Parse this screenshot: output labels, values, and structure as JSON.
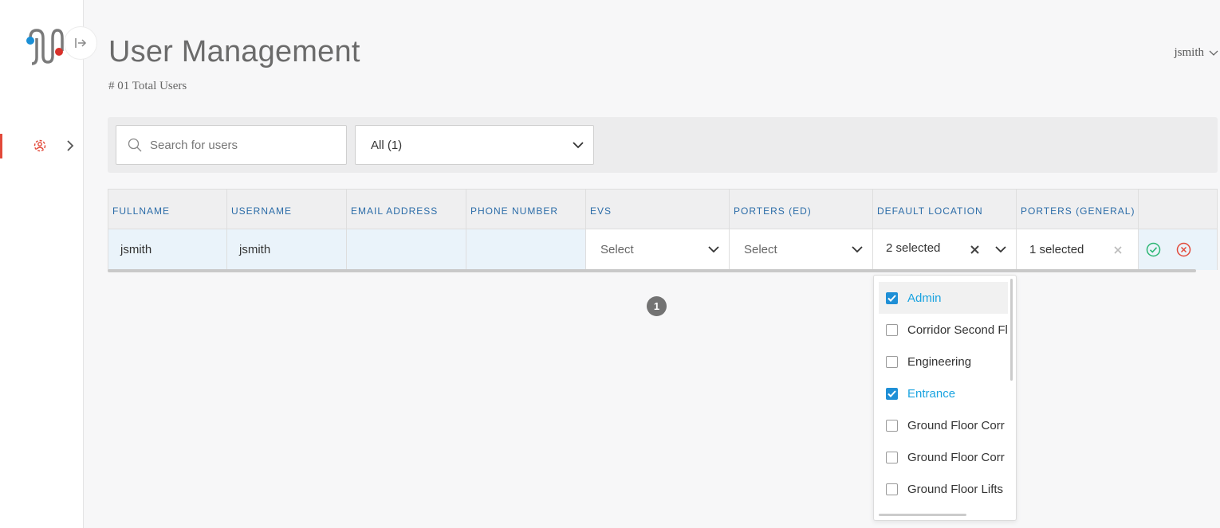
{
  "page": {
    "title": "User Management",
    "total_users": "# 01 Total Users"
  },
  "header": {
    "username": "jsmith"
  },
  "toolbar": {
    "search_placeholder": "Search for users",
    "filter_value": "All (1)"
  },
  "table": {
    "columns": [
      "FULLNAME",
      "USERNAME",
      "EMAIL ADDRESS",
      "PHONE NUMBER",
      "EVS",
      "PORTERS (ED)",
      "DEFAULT LOCATION",
      "PORTERS (GENERAL)",
      ""
    ],
    "row": {
      "fullname": "jsmith",
      "username": "jsmith",
      "email": "",
      "phone": "",
      "evs": "Select",
      "porters_ed": "Select",
      "default_location": "2 selected",
      "porters_general": "1 selected"
    }
  },
  "pagination": {
    "current_page": "1"
  },
  "location_dropdown": {
    "options": [
      {
        "label": "Admin",
        "checked": true
      },
      {
        "label": "Corridor Second Fl",
        "checked": false
      },
      {
        "label": "Engineering",
        "checked": false
      },
      {
        "label": "Entrance",
        "checked": true
      },
      {
        "label": "Ground Floor Corr",
        "checked": false
      },
      {
        "label": "Ground Floor Corr",
        "checked": false
      },
      {
        "label": "Ground Floor Lifts",
        "checked": false
      }
    ]
  },
  "colors": {
    "accent": "#1aa3e0",
    "header_text": "#2b6ca8",
    "danger": "#e2493a",
    "success": "#2bb673"
  },
  "icons": {
    "nav": "gear-users-icon",
    "save": "check-circle-icon",
    "cancel": "x-circle-icon"
  }
}
